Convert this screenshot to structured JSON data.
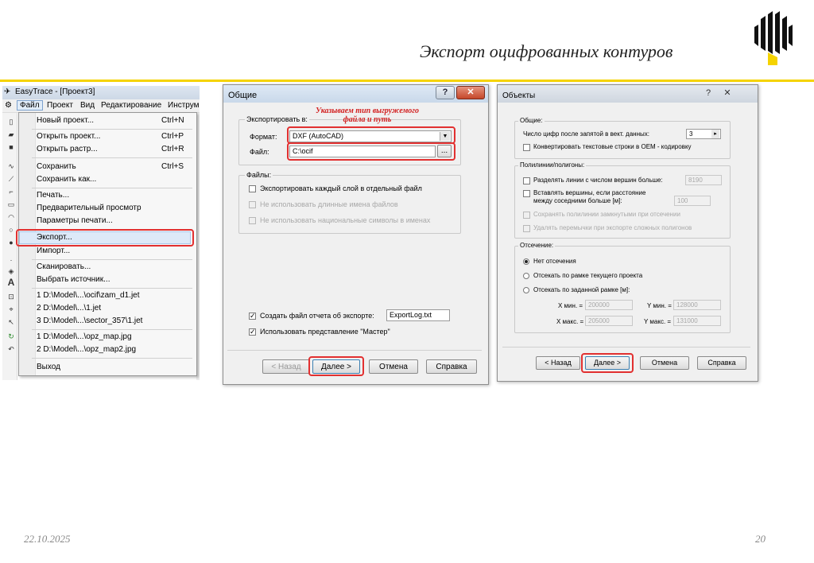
{
  "slide": {
    "title": "Экспорт оцифрованных контуров",
    "date": "22.10.2025",
    "page": "20"
  },
  "colors": {
    "accent": "#f5d300",
    "highlight": "#e23030",
    "annotation": "#d22020"
  },
  "easytrace": {
    "title": "EasyTrace - [Проект3]",
    "menubar": [
      "Файл",
      "Проект",
      "Вид",
      "Редактирование",
      "Инструм"
    ],
    "file_menu": [
      {
        "label": "Новый проект...",
        "shortcut": "Ctrl+N"
      },
      {
        "label": "Открыть проект...",
        "shortcut": "Ctrl+P"
      },
      {
        "label": "Открыть растр...",
        "shortcut": "Ctrl+R"
      },
      {
        "label": "Сохранить",
        "shortcut": "Ctrl+S"
      },
      {
        "label": "Сохранить как..."
      },
      {
        "label": "Печать..."
      },
      {
        "label": "Предварительный просмотр"
      },
      {
        "label": "Параметры печати..."
      },
      {
        "label": "Экспорт..."
      },
      {
        "label": "Импорт..."
      },
      {
        "label": "Сканировать..."
      },
      {
        "label": "Выбрать источник..."
      },
      {
        "label": "1 D:\\Model\\...\\ocif\\zam_d1.jet"
      },
      {
        "label": "2 D:\\Model\\...\\1.jet"
      },
      {
        "label": "3 D:\\Model\\...\\sector_357\\1.jet"
      },
      {
        "label": "1 D:\\Model\\...\\opz_map.jpg"
      },
      {
        "label": "2 D:\\Model\\...\\opz_map2.jpg"
      },
      {
        "label": "Выход"
      }
    ]
  },
  "dialog_general": {
    "title": "Общие",
    "help_glyph": "?",
    "close_glyph": "✕",
    "annotation": [
      "Указываем тип выгружемого",
      "файла и путь"
    ],
    "export_group": "Экспортировать в:",
    "format_label": "Формат:",
    "format_value": "DXF (AutoCAD)",
    "file_label": "Файл:",
    "file_value": "C:\\ocif",
    "browse_label": "...",
    "files_group": "Файлы:",
    "opt_each_layer": "Экспортировать каждый слой в отдельный файл",
    "opt_no_long_names": "Не использовать длинные имена файлов",
    "opt_no_national": "Не использовать национальные символы в именах",
    "report_label": "Создать файл отчета об экспорте:",
    "report_value": "ExportLog.txt",
    "master_label": "Использовать представление \"Мастер\"",
    "back": "< Назад",
    "next": "Далее >",
    "cancel": "Отмена",
    "help": "Справка"
  },
  "dialog_objects": {
    "title": "Объекты",
    "help_glyph": "?",
    "close_glyph": "✕",
    "common_group": "Общие:",
    "digits_label": "Число цифр после запятой в вект. данных:",
    "digits_value": "3",
    "convert_oem": "Конвертировать текстовые строки в OEM - кодировку",
    "poly_group": "Полилинии/полигоны:",
    "split_lines": "Разделять линии с числом вершин больше:",
    "split_value": "8190",
    "insert_vertices_1": "Вставлять вершины, если расстояние",
    "insert_vertices_2": "между соседними больше [м]:",
    "insert_value": "100",
    "keep_closed": "Сохранять полилинии замкнутыми при отсечении",
    "remove_jumps": "Удалять перемычки при экспорте сложных полигонов",
    "clip_group": "Отсечение:",
    "clip_none": "Нет отсечения",
    "clip_project": "Отсекать по рамке текущего проекта",
    "clip_custom": "Отсекать по заданной рамке [м]:",
    "xmin_label": "X мин. =",
    "xmin_value": "200000",
    "ymin_label": "Y мин. =",
    "ymin_value": "128000",
    "xmax_label": "X макс. =",
    "xmax_value": "205000",
    "ymax_label": "Y макс. =",
    "ymax_value": "131000",
    "back": "< Назад",
    "next": "Далее >",
    "cancel": "Отмена",
    "help": "Справка"
  }
}
